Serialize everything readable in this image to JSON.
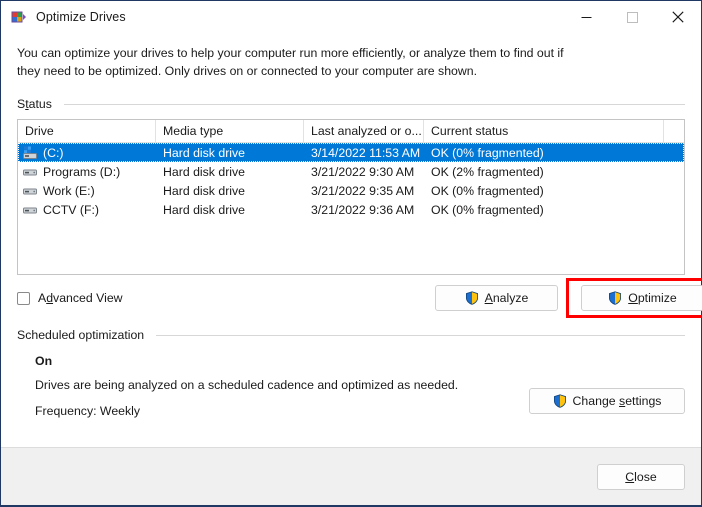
{
  "window": {
    "title": "Optimize Drives",
    "icon": "defrag-icon",
    "controls": {
      "minimize": "minimize-icon",
      "maximize": "maximize-icon",
      "close": "close-icon"
    }
  },
  "description": "You can optimize your drives to help your computer run more efficiently, or analyze them to find out if they need to be optimized. Only drives on or connected to your computer are shown.",
  "status_group": {
    "label_pre": "S",
    "label_acc": "t",
    "label_post": "atus",
    "label_full": "Status"
  },
  "table": {
    "columns": [
      "Drive",
      "Media type",
      "Last analyzed or o...",
      "Current status",
      ""
    ],
    "rows": [
      {
        "icon": "system-drive-icon",
        "drive": "(C:)",
        "media_type": "Hard disk drive",
        "last_analyzed": "3/14/2022 11:53 AM",
        "current_status": "OK (0% fragmented)",
        "selected": true
      },
      {
        "icon": "drive-icon",
        "drive": "Programs (D:)",
        "media_type": "Hard disk drive",
        "last_analyzed": "3/21/2022 9:30 AM",
        "current_status": "OK (2% fragmented)",
        "selected": false
      },
      {
        "icon": "drive-icon",
        "drive": "Work (E:)",
        "media_type": "Hard disk drive",
        "last_analyzed": "3/21/2022 9:35 AM",
        "current_status": "OK (0% fragmented)",
        "selected": false
      },
      {
        "icon": "drive-icon",
        "drive": "CCTV (F:)",
        "media_type": "Hard disk drive",
        "last_analyzed": "3/21/2022 9:36 AM",
        "current_status": "OK (0% fragmented)",
        "selected": false
      }
    ]
  },
  "advanced_view": {
    "label_pre": "A",
    "label_acc": "d",
    "label_post": "vanced View",
    "checked": false
  },
  "buttons": {
    "analyze": {
      "pre": "",
      "acc": "A",
      "post": "nalyze",
      "shield": true
    },
    "optimize": {
      "pre": "",
      "acc": "O",
      "post": "ptimize",
      "shield": true,
      "highlighted": true
    },
    "change_settings": {
      "pre": "Change ",
      "acc": "s",
      "post": "ettings",
      "shield": true
    },
    "close": {
      "pre": "",
      "acc": "C",
      "post": "lose",
      "shield": false
    }
  },
  "scheduled_group": {
    "label_full": "Scheduled optimization",
    "state": "On",
    "description": "Drives are being analyzed on a scheduled cadence and optimized as needed.",
    "frequency": "Frequency: Weekly"
  },
  "colors": {
    "selection_blue": "#0078d7",
    "highlight_red": "#ff0000",
    "window_border": "#1f3864",
    "footer_bg": "#f0f0f0",
    "shield_blue": "#1c6fd0",
    "shield_gold": "#ffc20e"
  }
}
